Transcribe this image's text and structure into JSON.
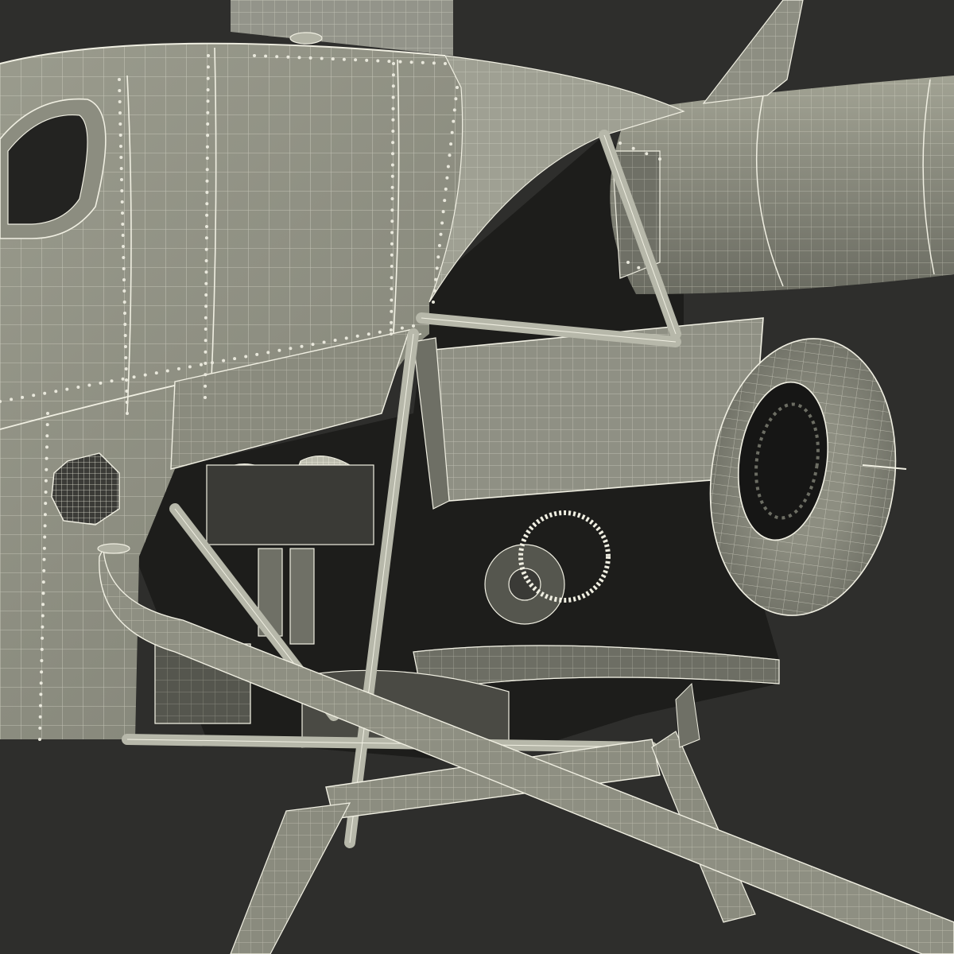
{
  "scene": {
    "subject": "",
    "colors": {
      "background": "#2e2e2c",
      "surface": "#8b8c7f",
      "surface_light": "#a6a798",
      "surface_dark": "#5d5e55",
      "interior": "#1d1d1b",
      "wire": "#f0efe2",
      "rivet": "#e9e8dc"
    }
  }
}
